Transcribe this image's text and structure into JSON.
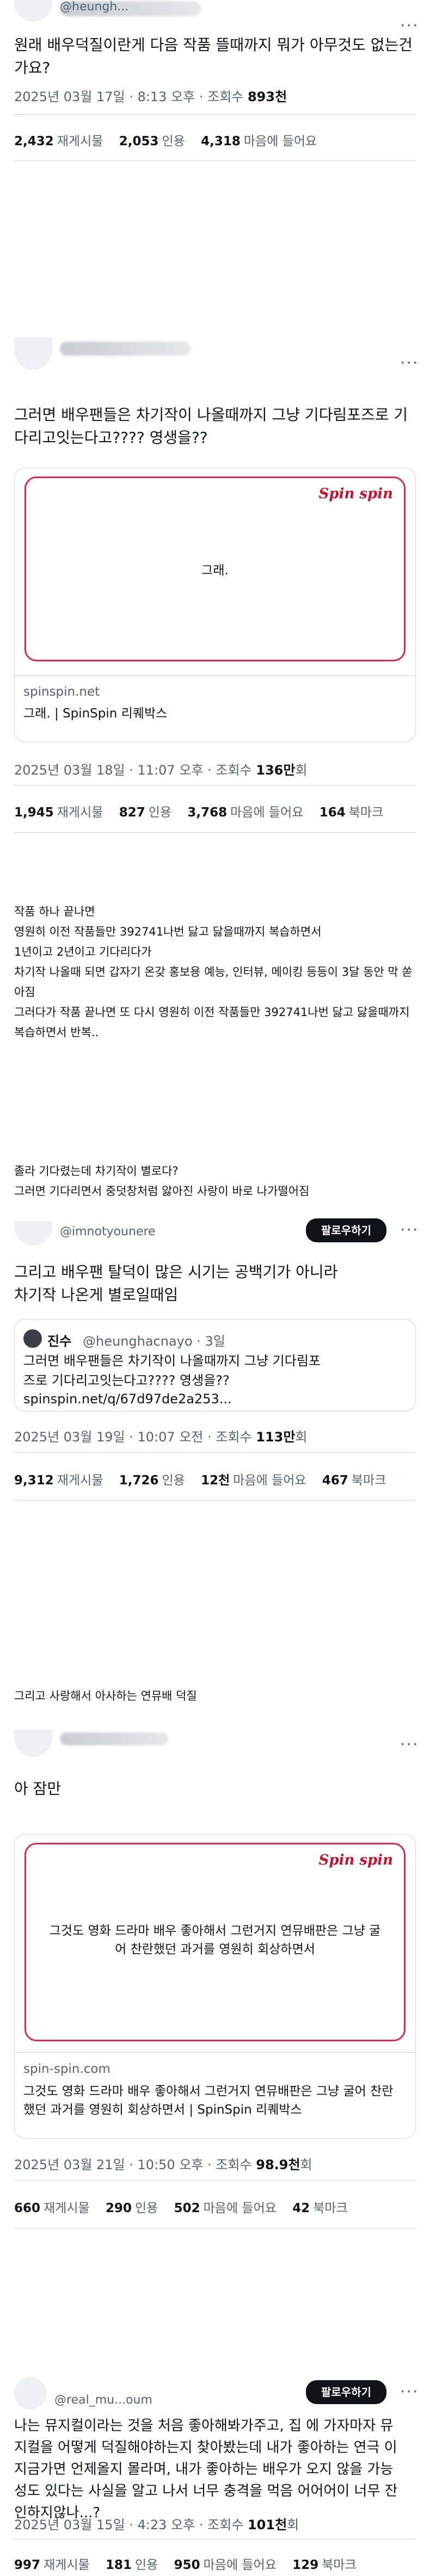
{
  "t1": {
    "handle": "@heungh...",
    "text": "원래 배우덕질이란게 다음 작품 뜰때까지 뭐가 아무것도 없는건가요?",
    "meta_time": "2025년 03월 17일 · 8:13 오후 · 조회수 ",
    "views": "893천",
    "stats": [
      {
        "n": "2,432",
        "l": "재게시물"
      },
      {
        "n": "2,053",
        "l": "인용"
      },
      {
        "n": "4,318",
        "l": "마음에 들어요"
      }
    ]
  },
  "t2": {
    "text": "그러면 배우팬들은 차기작이 나올때까지 그냥 기다림포즈로 기다리고잇는다고???? 영생을??",
    "card_logo": "Spin spin",
    "card_text": "그래.",
    "card_domain": "spinspin.net",
    "card_title": "그래. | SpinSpin 리퀘박스",
    "meta_time": "2025년 03월 18일 · 11:07 오후 · 조회수 ",
    "views": "136만",
    "views_suffix": "회",
    "stats": [
      {
        "n": "1,945",
        "l": "재게시물"
      },
      {
        "n": "827",
        "l": "인용"
      },
      {
        "n": "3,768",
        "l": "마음에 들어요"
      },
      {
        "n": "164",
        "l": "북마크"
      }
    ]
  },
  "text_block1": [
    "작품 하나 끝나면",
    "영원히 이전 작품들만 392741나번 닳고 닳을때까지 복습하면서",
    "1년이고 2년이고 기다리다가",
    "차기작 나올때 되면 갑자기 온갖 홍보용 예능, 인터뷰, 메이킹 등등이 3달 동안 막 쏟아짐",
    "그러다가 작품 끝나면 또 다시 영원히 이전 작품들만 392741나번 닳고 닳을때까지 복습하면서 반복.."
  ],
  "text_block2": [
    "졸라 기다렸는데 차기작이 별로다?",
    "그러면 기다리면서 중덧창처럼 앓아진 사랑이 바로 나가떨어짐"
  ],
  "t3": {
    "handle": "@imnotyounere",
    "follow": "팔로우하기",
    "text": "그리고 배우팬 탈덕이 많은 시기는 공백기가 아니라 차기작 나온게 별로일때임",
    "q_name": "진수",
    "q_handle": "@heunghacnayo · 3일",
    "q_text": "그러면 배우팬들은 차기작이 나올때까지 그냥 기다림포즈로 기다리고잇는다고???? 영생을??",
    "q_link": "spinspin.net/q/67d97de2a253...",
    "meta_time": "2025년 03월 19일 · 10:07 오전 · 조회수 ",
    "views": "113만",
    "views_suffix": "회",
    "stats": [
      {
        "n": "9,312",
        "l": "재게시물"
      },
      {
        "n": "1,726",
        "l": "인용"
      },
      {
        "n": "12천",
        "l": "마음에 들어요"
      },
      {
        "n": "467",
        "l": "북마크"
      }
    ]
  },
  "text_block3": "그리고 사랑해서 아사하는 연뮤배 덕질",
  "t4": {
    "text": "아 잠만",
    "card_logo": "Spin spin",
    "card_text": "그것도 영화 드라마 배우 좋아해서 그런거지 연뮤배판은 그냥 굴어 찬란했던 과거를 영원히 회상하면서",
    "card_domain": "spin-spin.com",
    "card_title": "그것도 영화 드라마 배우 좋아해서 그런거지 연뮤배판은 그냥 굴어 찬란했던 과거를 영원히 회상하면서 | SpinSpin 리퀘박스",
    "meta_time": "2025년 03월 21일 · 10:50 오후 · 조회수 ",
    "views": "98.9천",
    "views_suffix": "회",
    "stats": [
      {
        "n": "660",
        "l": "재게시물"
      },
      {
        "n": "290",
        "l": "인용"
      },
      {
        "n": "502",
        "l": "마음에 들어요"
      },
      {
        "n": "42",
        "l": "북마크"
      }
    ]
  },
  "t5": {
    "handle": "@real_mu...oum",
    "follow": "팔로우하기",
    "text": "나는 뮤지컬이라는 것을 처음 좋아해봐가주고, 집 에 가자마자 뮤지컬을 어떻게 덕질해야하는지 찾아봤는데 내가 좋아하는 연극 이 지금가면 언제올지 몰라며, 내가 좋아하는 배우가 오지 않을 가능성도 있다는 사실을 알고 나서 너무 충격을 먹음 어어어이 너무 잔인하지않나...?",
    "meta_time": "2025년 03월 15일 · 4:23 오후 · 조회수 ",
    "views": "101천",
    "views_suffix": "회",
    "stats": [
      {
        "n": "997",
        "l": "재게시물"
      },
      {
        "n": "181",
        "l": "인용"
      },
      {
        "n": "950",
        "l": "마음에 들어요"
      },
      {
        "n": "129",
        "l": "북마크"
      }
    ]
  }
}
